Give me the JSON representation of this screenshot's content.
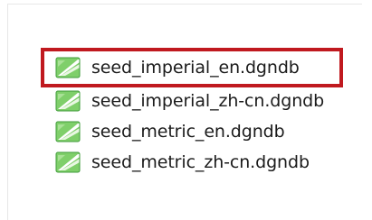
{
  "files": [
    {
      "name": "seed_imperial_en.dgndb",
      "icon": "dgndb-file-icon",
      "highlighted": true,
      "highlight_color": "#c0191f"
    },
    {
      "name": "seed_imperial_zh-cn.dgndb",
      "icon": "dgndb-file-icon",
      "highlighted": false
    },
    {
      "name": "seed_metric_en.dgndb",
      "icon": "dgndb-file-icon",
      "highlighted": false
    },
    {
      "name": "seed_metric_zh-cn.dgndb",
      "icon": "dgndb-file-icon",
      "highlighted": false
    }
  ],
  "colors": {
    "icon_green": "#5cb85c",
    "icon_dark_green": "#2f8f2f",
    "highlight_border": "#c0191f"
  }
}
